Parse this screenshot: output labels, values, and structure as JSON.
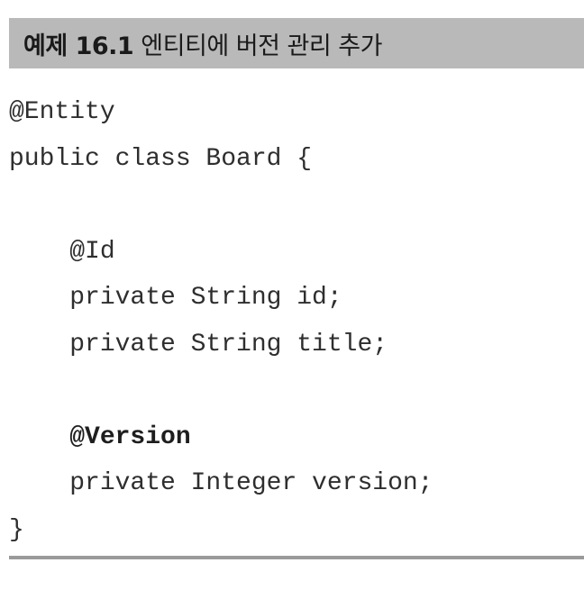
{
  "header": {
    "label": "예제 16.1",
    "title": "엔티티에 버전 관리 추가"
  },
  "code": {
    "lines": [
      "@Entity",
      "public class Board {",
      "",
      "    @Id",
      "    private String id;",
      "    private String title;",
      "",
      "    @Version",
      "    private Integer version;",
      "}"
    ]
  }
}
